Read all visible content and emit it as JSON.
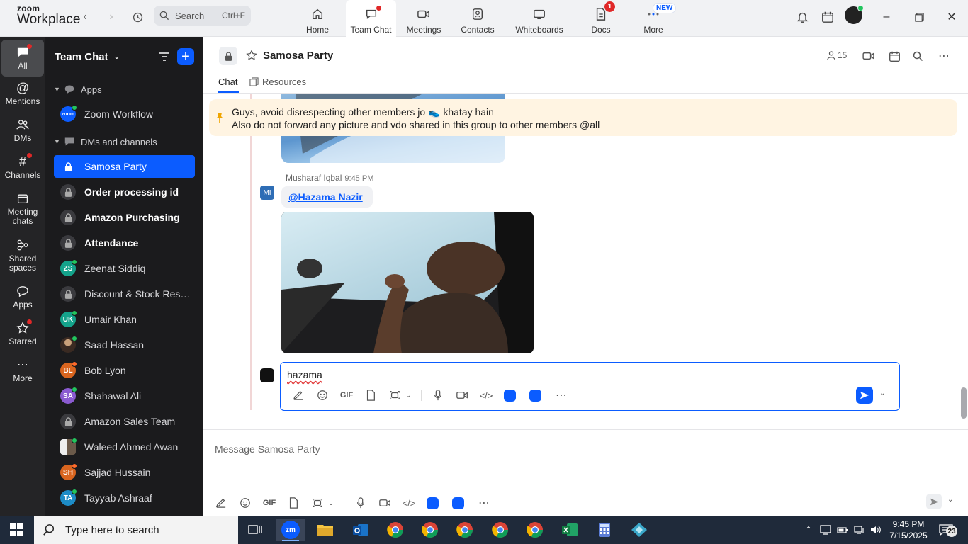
{
  "app": {
    "logo_line1": "zoom",
    "logo_line2": "Workplace",
    "search_label": "Search",
    "search_shortcut": "Ctrl+F",
    "accent_color": "#0b5cff"
  },
  "tabs": [
    {
      "label": "Home",
      "icon": "home-icon"
    },
    {
      "label": "Team Chat",
      "icon": "chat-icon"
    },
    {
      "label": "Meetings",
      "icon": "video-icon"
    },
    {
      "label": "Contacts",
      "icon": "contacts-icon"
    },
    {
      "label": "Whiteboards",
      "icon": "whiteboard-icon"
    },
    {
      "label": "Docs",
      "icon": "docs-icon",
      "badge": "1"
    },
    {
      "label": "More",
      "icon": "more-icon",
      "badge": "NEW"
    }
  ],
  "rail": [
    {
      "label": "All"
    },
    {
      "label": "Mentions"
    },
    {
      "label": "DMs"
    },
    {
      "label": "Channels"
    },
    {
      "label": "Meeting chats"
    },
    {
      "label": "Shared spaces"
    },
    {
      "label": "Apps"
    },
    {
      "label": "Starred"
    },
    {
      "label": "More"
    }
  ],
  "sidebar": {
    "title": "Team Chat",
    "sections": [
      {
        "label": "Apps"
      },
      {
        "label": "DMs and channels"
      }
    ],
    "items": [
      {
        "label": "Zoom Workflow",
        "type": "app"
      },
      {
        "label": "Samosa Party",
        "type": "channel"
      },
      {
        "label": "Order processing id",
        "type": "channel"
      },
      {
        "label": "Amazon Purchasing",
        "type": "channel"
      },
      {
        "label": "Attendance",
        "type": "channel"
      },
      {
        "label": "Zeenat Siddiq",
        "type": "dm",
        "initials": "ZS",
        "color": "#14a38b"
      },
      {
        "label": "Discount & Stock Reser...",
        "type": "channel"
      },
      {
        "label": "Umair Khan",
        "type": "dm",
        "initials": "UK",
        "color": "#14a38b"
      },
      {
        "label": "Saad Hassan",
        "type": "dm",
        "initials": "",
        "color": "#6b5a4a"
      },
      {
        "label": "Bob Lyon",
        "type": "dm",
        "initials": "BL",
        "color": "#d9651f"
      },
      {
        "label": "Shahawal Ali",
        "type": "dm",
        "initials": "SA",
        "color": "#8b5bd1"
      },
      {
        "label": "Amazon Sales Team",
        "type": "channel"
      },
      {
        "label": "Waleed Ahmed Awan",
        "type": "dm",
        "initials": "",
        "color": "#7a7a7a"
      },
      {
        "label": "Sajjad Hussain",
        "type": "dm",
        "initials": "SH",
        "color": "#d9651f"
      },
      {
        "label": "Tayyab Ashraaf",
        "type": "dm",
        "initials": "TA",
        "color": "#1d8cc7"
      }
    ]
  },
  "channel": {
    "title": "Samosa Party",
    "member_count": "15",
    "tabs": [
      "Chat",
      "Resources"
    ],
    "pinned_line1": "Guys, avoid disrespecting other members jo 👟 khatay hain",
    "pinned_line2": "Also do not forward any picture and vdo shared in this group to other members @all"
  },
  "message": {
    "sender": "Musharaf Iqbal",
    "time": "9:45 PM",
    "avatar_initials": "MI",
    "mention": "@Hazama Nazir"
  },
  "reply": {
    "text": "hazama",
    "gif_label": "GIF"
  },
  "composer": {
    "placeholder": "Message Samosa Party",
    "gif_label": "GIF"
  },
  "taskbar": {
    "search_placeholder": "Type here to search",
    "time": "9:45 PM",
    "date": "7/15/2025",
    "notification_count": "23"
  }
}
